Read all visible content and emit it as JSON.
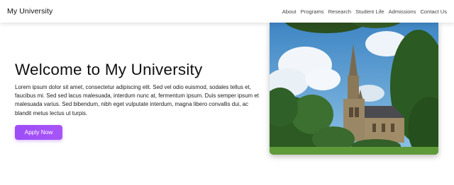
{
  "header": {
    "brand": "My University",
    "nav": [
      "About",
      "Programs",
      "Research",
      "Student Life",
      "Admissions",
      "Contact Us"
    ]
  },
  "hero": {
    "title": "Welcome to My University",
    "body": "Lorem ipsum dolor sit amet, consectetur adipiscing elit. Sed vel odio euismod, sodales tellus et, faucibus mi. Sed sed lacus malesuada, interdum nunc at, fermentum ipsum. Duis semper ipsum et malesuada varius. Sed bibendum, nibh eget vulputate interdum, magna libero convallis dui, ac blandit metus lectus ut turpis.",
    "cta_label": "Apply Now"
  },
  "colors": {
    "accent": "#a855f7",
    "background": "#ffffff",
    "text": "#111111"
  }
}
